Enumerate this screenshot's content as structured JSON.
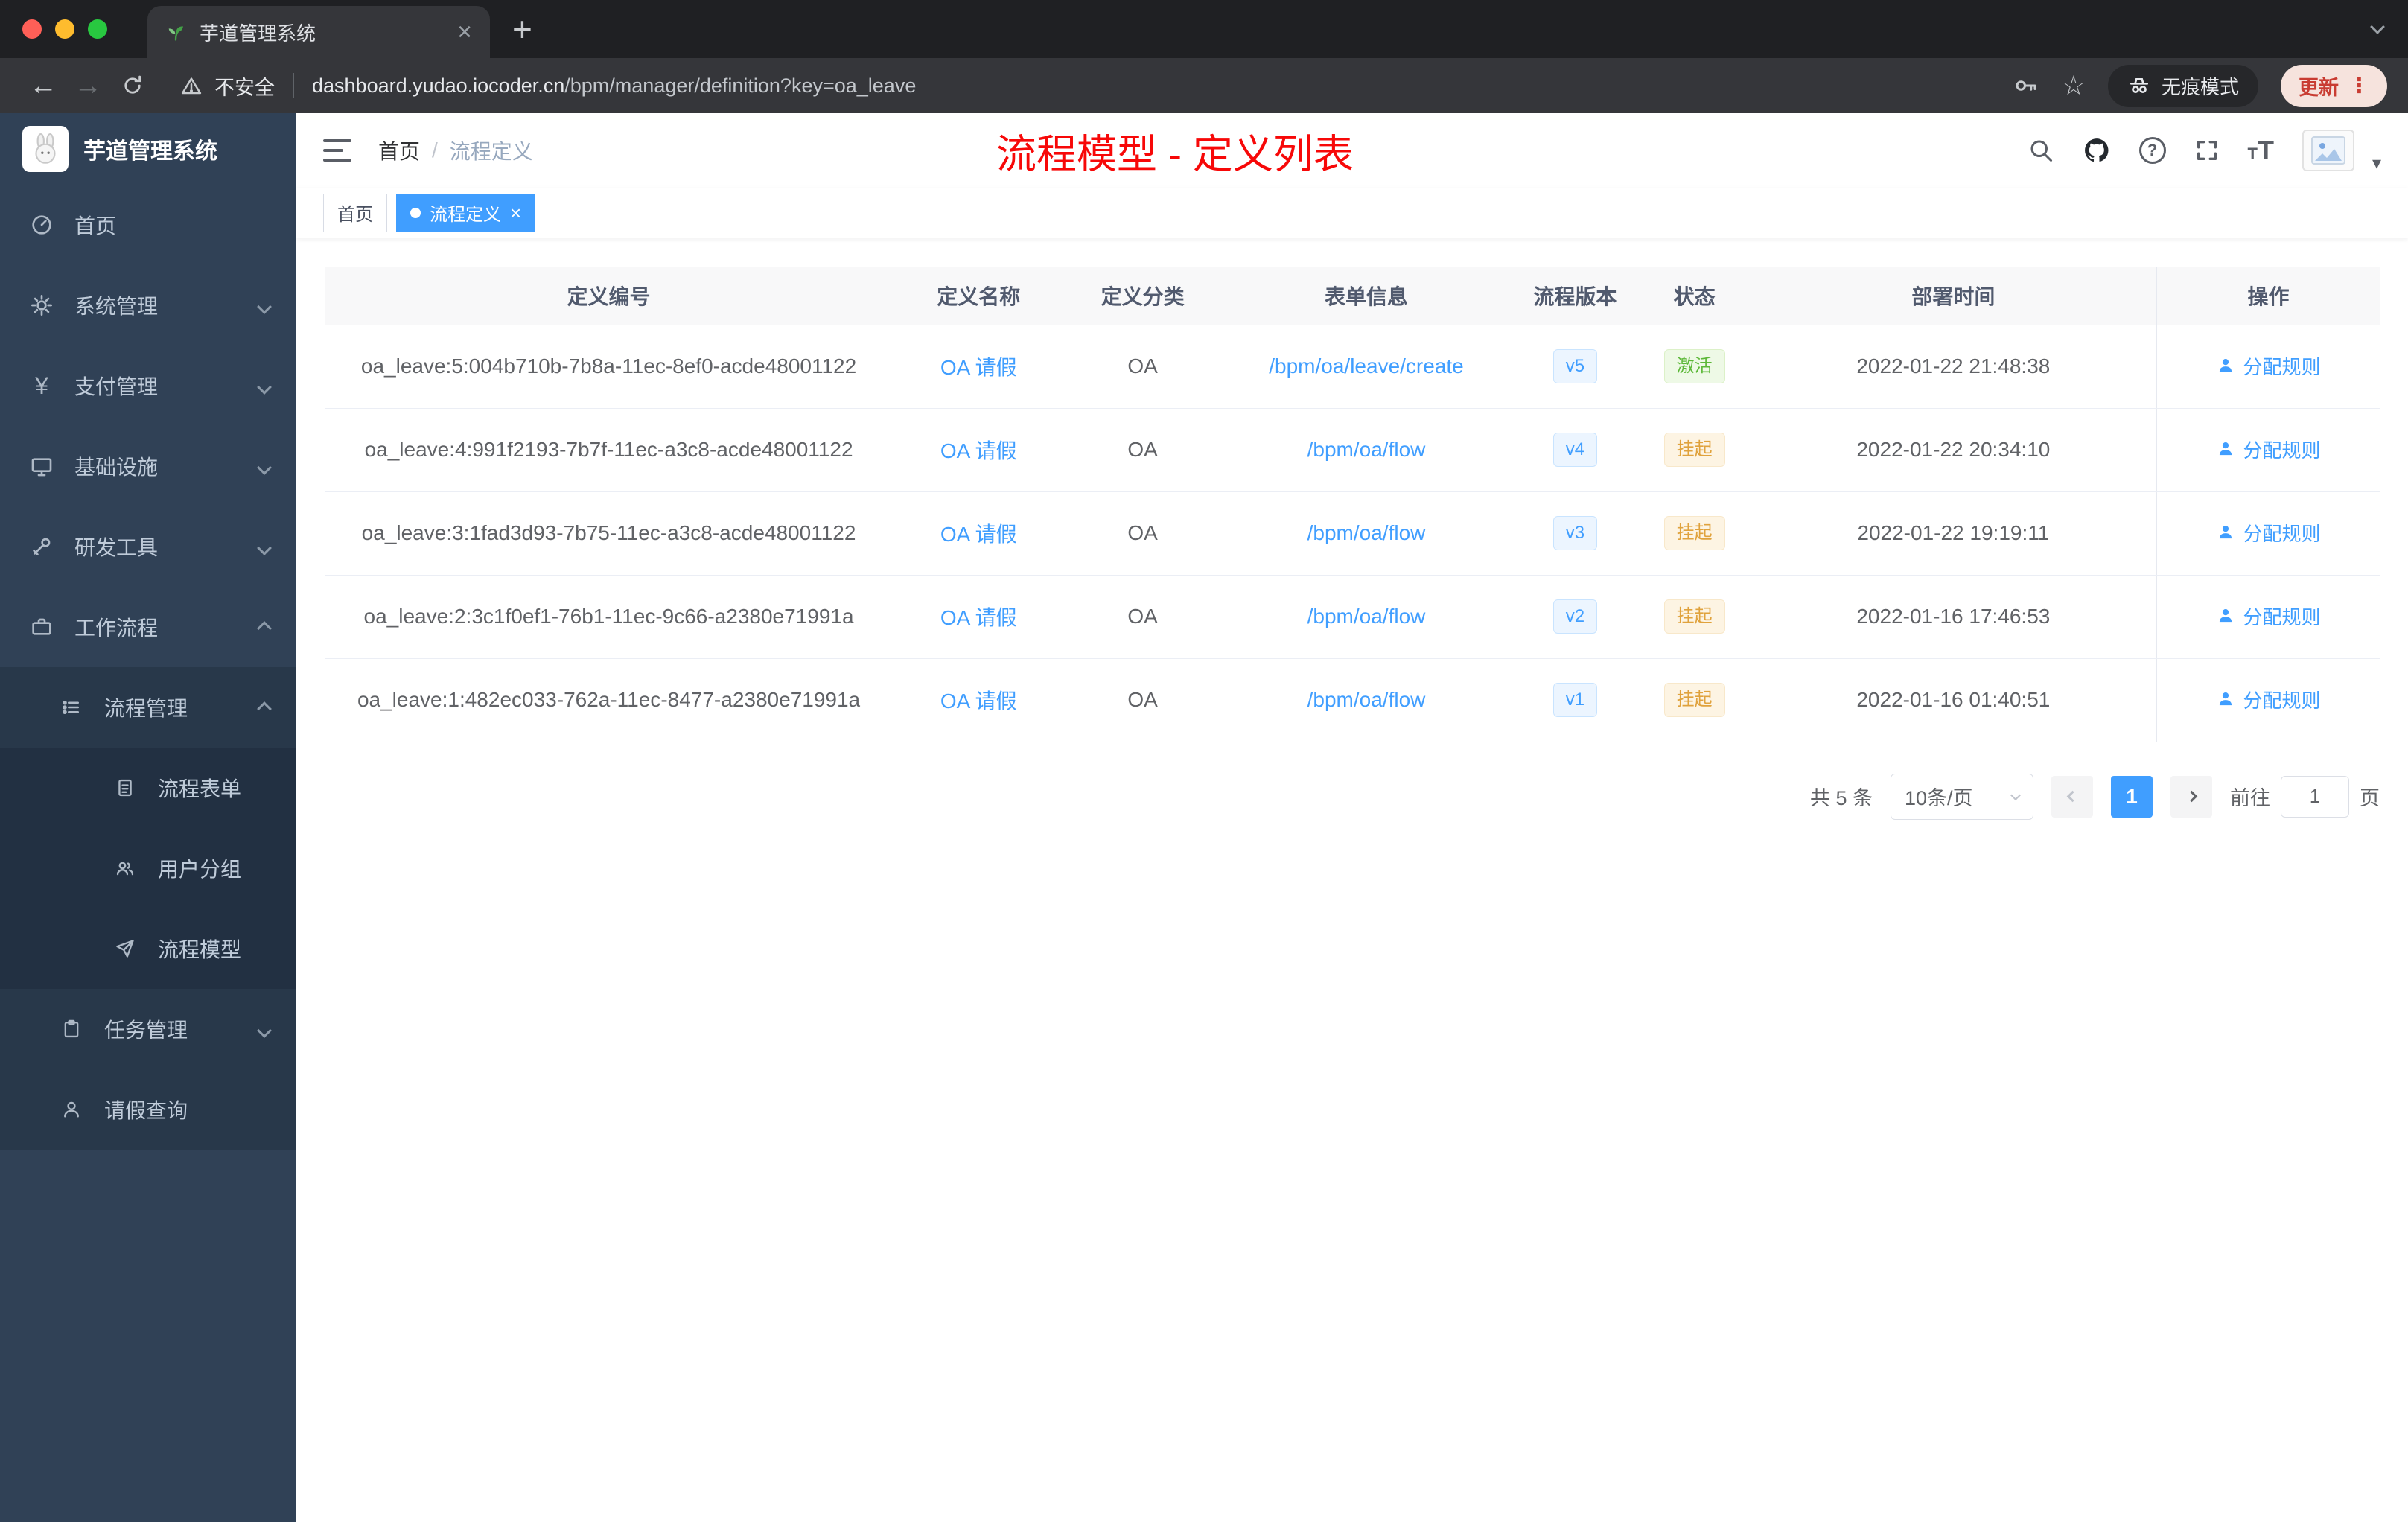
{
  "colors": {
    "accent": "#409eff",
    "annotation_red": "#f70808",
    "status_active_green": "#5cb838",
    "status_suspended_orange": "#e0a23c",
    "sidebar_bg": "#304156"
  },
  "browser": {
    "tab_title": "芋道管理系统",
    "security_label": "不安全",
    "url_host": "dashboard.yudao.iocoder.cn",
    "url_path": "/bpm/manager/definition?key=oa_leave",
    "incognito_label": "无痕模式",
    "update_label": "更新"
  },
  "sidebar": {
    "logo_title": "芋道管理系统",
    "items": [
      {
        "label": "首页"
      },
      {
        "label": "系统管理"
      },
      {
        "label": "支付管理"
      },
      {
        "label": "基础设施"
      },
      {
        "label": "研发工具"
      },
      {
        "label": "工作流程"
      },
      {
        "label": "流程管理"
      },
      {
        "label": "流程表单"
      },
      {
        "label": "用户分组"
      },
      {
        "label": "流程模型"
      },
      {
        "label": "任务管理"
      },
      {
        "label": "请假查询"
      }
    ]
  },
  "header": {
    "breadcrumb_home": "首页",
    "breadcrumb_separator": "/",
    "breadcrumb_current": "流程定义",
    "annotation": "流程模型 - 定义列表"
  },
  "tags": {
    "home": "首页",
    "current": "流程定义"
  },
  "table": {
    "columns": [
      "定义编号",
      "定义名称",
      "定义分类",
      "表单信息",
      "流程版本",
      "状态",
      "部署时间",
      "操作"
    ],
    "rows": [
      {
        "id": "oa_leave:5:004b710b-7b8a-11ec-8ef0-acde48001122",
        "name": "OA 请假",
        "category": "OA",
        "form": "/bpm/oa/leave/create",
        "version": "v5",
        "status": "激活",
        "time": "2022-01-22 21:48:38",
        "action": "分配规则"
      },
      {
        "id": "oa_leave:4:991f2193-7b7f-11ec-a3c8-acde48001122",
        "name": "OA 请假",
        "category": "OA",
        "form": "/bpm/oa/flow",
        "version": "v4",
        "status": "挂起",
        "time": "2022-01-22 20:34:10",
        "action": "分配规则"
      },
      {
        "id": "oa_leave:3:1fad3d93-7b75-11ec-a3c8-acde48001122",
        "name": "OA 请假",
        "category": "OA",
        "form": "/bpm/oa/flow",
        "version": "v3",
        "status": "挂起",
        "time": "2022-01-22 19:19:11",
        "action": "分配规则"
      },
      {
        "id": "oa_leave:2:3c1f0ef1-76b1-11ec-9c66-a2380e71991a",
        "name": "OA 请假",
        "category": "OA",
        "form": "/bpm/oa/flow",
        "version": "v2",
        "status": "挂起",
        "time": "2022-01-16 17:46:53",
        "action": "分配规则"
      },
      {
        "id": "oa_leave:1:482ec033-762a-11ec-8477-a2380e71991a",
        "name": "OA 请假",
        "category": "OA",
        "form": "/bpm/oa/flow",
        "version": "v1",
        "status": "挂起",
        "time": "2022-01-16 01:40:51",
        "action": "分配规则"
      }
    ]
  },
  "pagination": {
    "total": "共 5 条",
    "page_size": "10条/页",
    "current_page": "1",
    "goto_label": "前往",
    "goto_value": "1",
    "goto_unit": "页"
  }
}
